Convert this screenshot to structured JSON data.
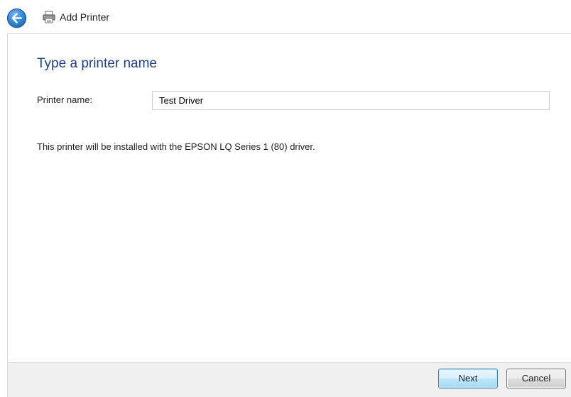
{
  "window": {
    "title": "Add Printer",
    "back_icon": "back-arrow-icon",
    "title_icon": "printer-icon"
  },
  "page": {
    "heading": "Type a printer name",
    "printer_name_label": "Printer name:",
    "printer_name_value": "Test Driver",
    "info_text": "This printer will be installed with the EPSON LQ Series 1 (80) driver."
  },
  "buttons": {
    "next_label": "Next",
    "cancel_label": "Cancel"
  },
  "colors": {
    "heading": "#1e3f8a",
    "footer_bg": "#f0f0f0",
    "back_button": "#2c7fd0"
  }
}
